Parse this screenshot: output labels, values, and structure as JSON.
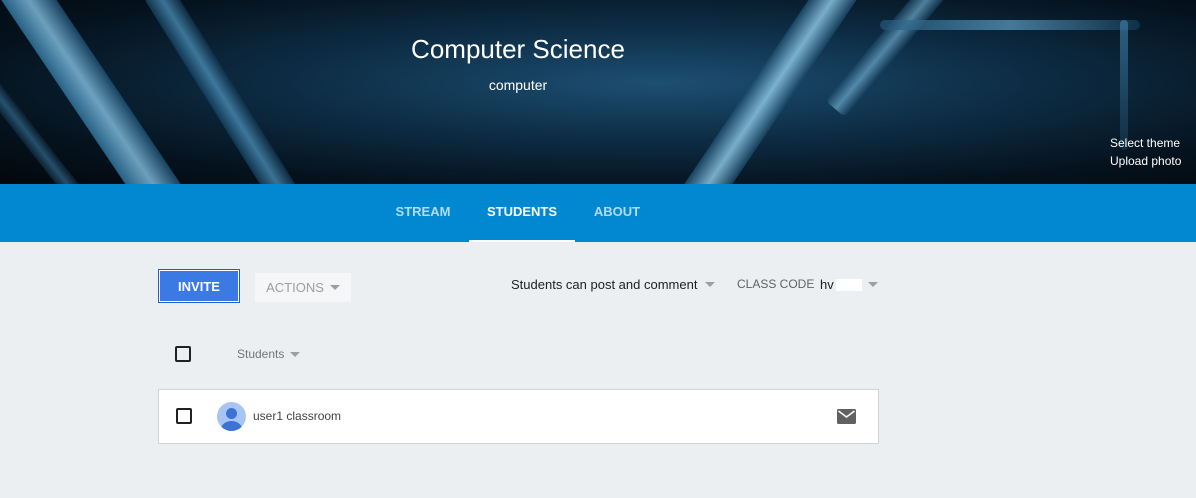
{
  "header": {
    "class_name": "Computer Science",
    "section": "computer",
    "select_theme": "Select theme",
    "upload_photo": "Upload photo"
  },
  "tabs": [
    {
      "label": "STREAM",
      "active": false
    },
    {
      "label": "STUDENTS",
      "active": true
    },
    {
      "label": "ABOUT",
      "active": false
    }
  ],
  "toolbar": {
    "invite_label": "INVITE",
    "actions_label": "ACTIONS",
    "post_setting": "Students can post and comment",
    "class_code_label": "CLASS CODE",
    "class_code_value": "hv"
  },
  "list": {
    "sort_label": "Students",
    "students": [
      {
        "name": "user1 classroom"
      }
    ]
  },
  "colors": {
    "tab_bar": "#0288d1",
    "invite_button": "#3b7ae4",
    "page_background": "#eceff1"
  }
}
